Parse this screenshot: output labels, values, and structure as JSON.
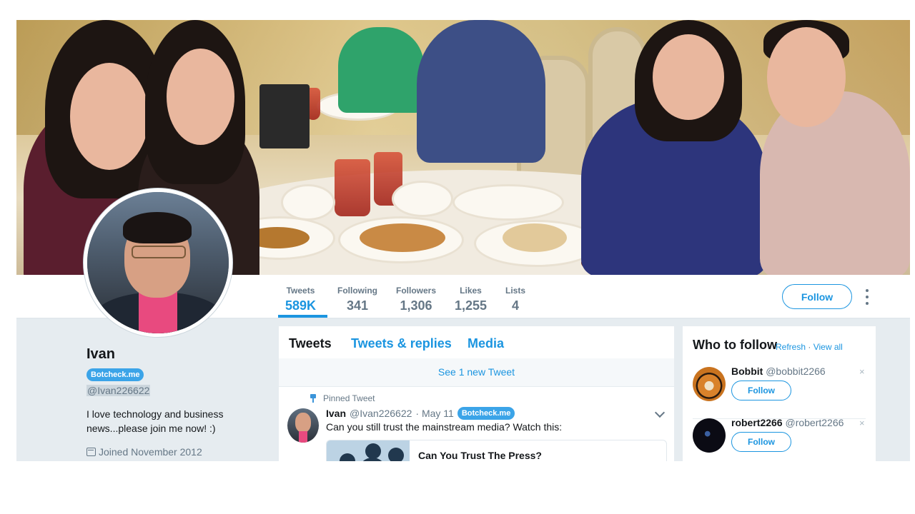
{
  "profile": {
    "name": "Ivan",
    "badge": "Botcheck.me",
    "handle": "@Ivan226622",
    "bio": "I love technology and business news...please join me now! :)",
    "joined": "Joined November 2012"
  },
  "stats": [
    {
      "label": "Tweets",
      "value": "589K"
    },
    {
      "label": "Following",
      "value": "341"
    },
    {
      "label": "Followers",
      "value": "1,306"
    },
    {
      "label": "Likes",
      "value": "1,255"
    },
    {
      "label": "Lists",
      "value": "4"
    }
  ],
  "actions": {
    "follow_label": "Follow"
  },
  "timeline": {
    "tabs": [
      "Tweets",
      "Tweets & replies",
      "Media"
    ],
    "new_tweet": "See 1 new Tweet",
    "pinned_label": "Pinned Tweet",
    "tweet": {
      "name": "Ivan",
      "handle": "@Ivan226622",
      "date": "· May 11",
      "badge": "Botcheck.me",
      "text": "Can you still trust the mainstream media? Watch this:",
      "card_title": "Can You Trust The Press?"
    }
  },
  "who_to_follow": {
    "title": "Who to follow",
    "refresh": "Refresh",
    "separator": "·",
    "view_all": "View all",
    "suggestions": [
      {
        "name": "Bobbit",
        "handle": "@bobbit2266",
        "button": "Follow",
        "dismiss": "×"
      },
      {
        "name": "robert2266",
        "handle": "@robert2266",
        "button": "Follow",
        "dismiss": "×"
      }
    ]
  },
  "colors": {
    "accent": "#1b95e0",
    "badge": "#3ba4e8",
    "background": "#e6ecf0"
  },
  "icons": [
    "calendar-icon",
    "pin-icon",
    "chevron-down-icon",
    "more-options-icon",
    "dismiss-icon"
  ]
}
